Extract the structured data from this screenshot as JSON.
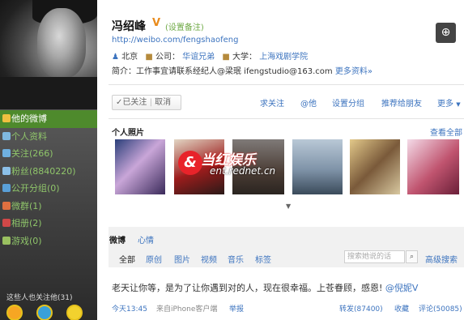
{
  "profile": {
    "name": "冯绍峰",
    "verified_mark": "V",
    "remark_link": "(设置备注)",
    "url": "http://weibo.com/fengshaofeng",
    "location": "北京",
    "company_label": "公司：",
    "company": "华谊兄弟",
    "university_label": "大学：",
    "university": "上海戏剧学院",
    "intro_label": "简介：",
    "intro": "工作事宜请联系经纪人@梁珉 ifengstudio@163.com",
    "more_info": "更多资料»"
  },
  "actions": {
    "followed": "✓已关注",
    "cancel": "取消",
    "items": [
      "求关注",
      "@他",
      "设置分组",
      "推荐给朋友",
      "更多"
    ]
  },
  "sidebar": {
    "items": [
      {
        "label": "他的微博",
        "icon": "home-icon"
      },
      {
        "label": "个人资料",
        "icon": "profile-icon"
      },
      {
        "label": "关注(266)",
        "icon": "follow-icon"
      },
      {
        "label": "粉丝(8840220)",
        "icon": "fans-icon"
      },
      {
        "label": "公开分组(0)",
        "icon": "group-icon"
      },
      {
        "label": "微群(1)",
        "icon": "community-icon"
      },
      {
        "label": "相册(2)",
        "icon": "album-icon"
      },
      {
        "label": "游戏(0)",
        "icon": "game-icon"
      }
    ],
    "following_title": "这些人也关注他(31)"
  },
  "photos": {
    "title": "个人照片",
    "see_all": "查看全部",
    "watermark_title": "当红娱乐",
    "watermark_url": "ent.rednet.cn"
  },
  "feed": {
    "tabs": [
      "微博",
      "心情"
    ],
    "filters": [
      "全部",
      "原创",
      "图片",
      "视频",
      "音乐",
      "标签"
    ],
    "search_placeholder": "搜索她说的话",
    "advanced_search": "高级搜索"
  },
  "post": {
    "text": "老天让你等，是为了让你遇到对的人，现在很幸福。上苍眷顾，感恩! ",
    "mention": "@倪妮V",
    "time": "今天13:45",
    "source": "来自iPhone客户端",
    "report": "举报",
    "repost": "转发(87400)",
    "favorite": "收藏",
    "comment": "评论(50085)"
  },
  "colors": {
    "link": "#3d74bf",
    "sidebar_active": "#4e8a2c",
    "verified": "#e98b1c"
  }
}
